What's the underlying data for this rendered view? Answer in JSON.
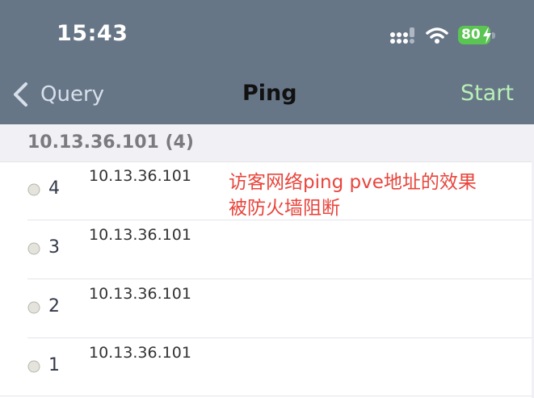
{
  "status_bar": {
    "time": "15:43",
    "battery": "80",
    "icons": [
      "cellular-signal-icon",
      "wifi-icon",
      "battery-charging-icon"
    ]
  },
  "nav": {
    "back_label": "Query",
    "title": "Ping",
    "action_label": "Start"
  },
  "section": {
    "title": "10.13.36.101 (4)"
  },
  "rows": [
    {
      "seq": "4",
      "host": "10.13.36.101"
    },
    {
      "seq": "3",
      "host": "10.13.36.101"
    },
    {
      "seq": "2",
      "host": "10.13.36.101"
    },
    {
      "seq": "1",
      "host": "10.13.36.101"
    }
  ],
  "annotation": {
    "line1": "访客网络ping pve地址的效果",
    "line2": "被防火墙阻断"
  },
  "colors": {
    "header_bg": "#677687",
    "start_accent": "#b9f0b6",
    "battery_green": "#5ac552",
    "annotation_red": "#e8453c"
  }
}
